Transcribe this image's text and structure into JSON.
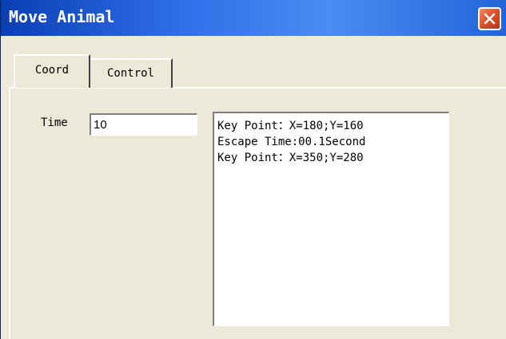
{
  "window": {
    "title": "Move Animal"
  },
  "tabs": [
    {
      "label": "Coord",
      "selected": true
    },
    {
      "label": "Control",
      "selected": false
    }
  ],
  "form": {
    "time_label": "Time",
    "time_value": "10"
  },
  "log": {
    "lines": [
      "Key Point：X=180;Y=160",
      "Escape Time:00.1Second",
      "Key Point：X=350;Y=280"
    ]
  },
  "colors": {
    "titlebar": "#2f6ee8",
    "window_bg": "#ece9d8",
    "close_button": "#dc4d23"
  },
  "icons": {
    "close": "close-icon"
  }
}
